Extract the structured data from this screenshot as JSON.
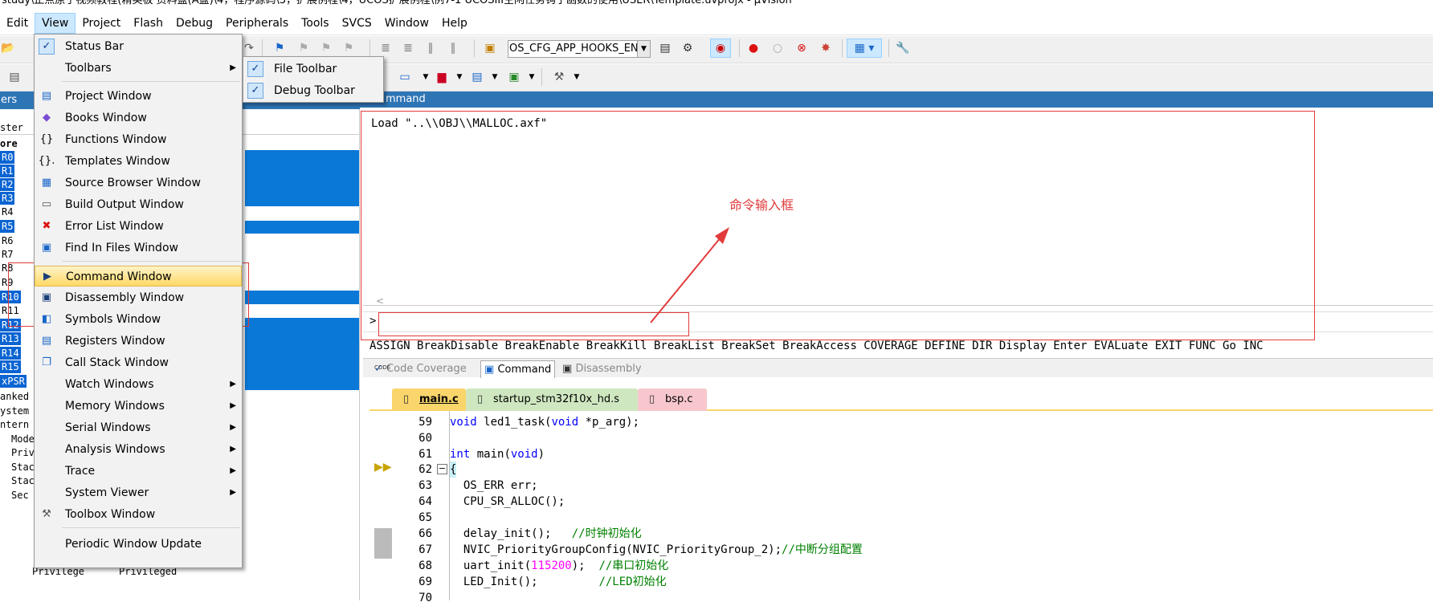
{
  "window": {
    "title": "study\\正点原子视频教程(精英板 资料盘(A盘)\\4，程序源码\\3，扩展例程\\4，UCOS扩展例程\\例7-1 UCOSIII空闲任务钩子函数的使用\\USER\\Template.uvprojx - µVision"
  },
  "menubar": [
    "Edit",
    "View",
    "Project",
    "Flash",
    "Debug",
    "Peripherals",
    "Tools",
    "SVCS",
    "Window",
    "Help"
  ],
  "toolbar": {
    "hooks_combo_value": "OS_CFG_APP_HOOKS_EN"
  },
  "left_panel": {
    "header": "ers",
    "col_header": "ster",
    "group": "ore",
    "registers": [
      "R0",
      "R1",
      "R2",
      "R3",
      "R4",
      "R5",
      "R6",
      "R7",
      "R8",
      "R9",
      "R10",
      "R11",
      "R12",
      "R13",
      "R14",
      "R15",
      "xPSR"
    ],
    "extras": [
      "anked",
      "ystem",
      "ntern",
      "Mode",
      "Priv",
      "Stac",
      "Stac",
      "Sec"
    ],
    "footer_a": "Privilege",
    "footer_b": "Privileged"
  },
  "view_menu": {
    "items": [
      {
        "label": "Status Bar",
        "icon": "check-icon"
      },
      {
        "label": "Toolbars",
        "icon": "none",
        "submenu": true
      },
      {
        "label": "Project Window",
        "icon": "project-window-icon"
      },
      {
        "label": "Books Window",
        "icon": "books-icon"
      },
      {
        "label": "Functions Window",
        "icon": "braces-icon"
      },
      {
        "label": "Templates Window",
        "icon": "templates-icon"
      },
      {
        "label": "Source Browser Window",
        "icon": "source-browser-icon"
      },
      {
        "label": "Build Output Window",
        "icon": "build-output-icon"
      },
      {
        "label": "Error List Window",
        "icon": "error-icon"
      },
      {
        "label": "Find In Files Window",
        "icon": "find-files-icon"
      },
      {
        "label": "Command Window",
        "icon": "command-window-icon",
        "highlighted": true
      },
      {
        "label": "Disassembly Window",
        "icon": "disassembly-icon"
      },
      {
        "label": "Symbols Window",
        "icon": "symbols-icon"
      },
      {
        "label": "Registers Window",
        "icon": "registers-icon"
      },
      {
        "label": "Call Stack Window",
        "icon": "call-stack-icon"
      },
      {
        "label": "Watch Windows",
        "icon": "none",
        "submenu": true
      },
      {
        "label": "Memory Windows",
        "icon": "none",
        "submenu": true
      },
      {
        "label": "Serial Windows",
        "icon": "none",
        "submenu": true
      },
      {
        "label": "Analysis Windows",
        "icon": "none",
        "submenu": true
      },
      {
        "label": "Trace",
        "icon": "none",
        "submenu": true
      },
      {
        "label": "System Viewer",
        "icon": "none",
        "submenu": true
      },
      {
        "label": "Toolbox Window",
        "icon": "toolbox-icon"
      },
      {
        "label": "Periodic Window Update",
        "icon": "none"
      }
    ],
    "toolbars_submenu": [
      "File Toolbar",
      "Debug Toolbar"
    ]
  },
  "command_window": {
    "tab_label": "mmand",
    "output": "Load \"..\\\\OBJ\\\\MALLOC.axf\"",
    "prompt": ">",
    "help_line": "ASSIGN BreakDisable BreakEnable BreakKill BreakList BreakSet BreakAccess COVERAGE DEFINE DIR Display Enter EVALuate EXIT FUNC Go INC",
    "annotation": "命令输入框"
  },
  "bottom_tabs": {
    "code_coverage": "Code Coverage",
    "command": "Command",
    "disassembly": "Disassembly",
    "code_badge": "CODE"
  },
  "editor": {
    "tabs": [
      "main.c",
      "startup_stm32f10x_hd.s",
      "bsp.c"
    ],
    "line_numbers": [
      "59",
      "60",
      "61",
      "62",
      "63",
      "64",
      "65",
      "66",
      "67",
      "68",
      "69",
      "70"
    ],
    "code": {
      "l59_a": "void ",
      "l59_b": "led1_task(",
      "l59_c": "void",
      "l59_d": " *p_arg);",
      "l61_a": "int",
      "l61_b": " main(",
      "l61_c": "void",
      "l61_d": ")",
      "l62": "{",
      "l63": "  OS_ERR err;",
      "l64": "  CPU_SR_ALLOC();",
      "l66_a": "  delay_init();   ",
      "l66_b": "//时钟初始化",
      "l67_a": "  NVIC_PriorityGroupConfig(NVIC_PriorityGroup_2);",
      "l67_b": "//中断分组配置",
      "l68_a": "  uart_init(",
      "l68_b": "115200",
      "l68_c": ");  ",
      "l68_d": "//串口初始化",
      "l69_a": "  LED_Init();         ",
      "l69_b": "//LED初始化"
    }
  },
  "colors": {
    "accent_blue": "#2e75b6",
    "annotation_red": "#e23b3b",
    "menu_highlight": "#ffd966"
  }
}
